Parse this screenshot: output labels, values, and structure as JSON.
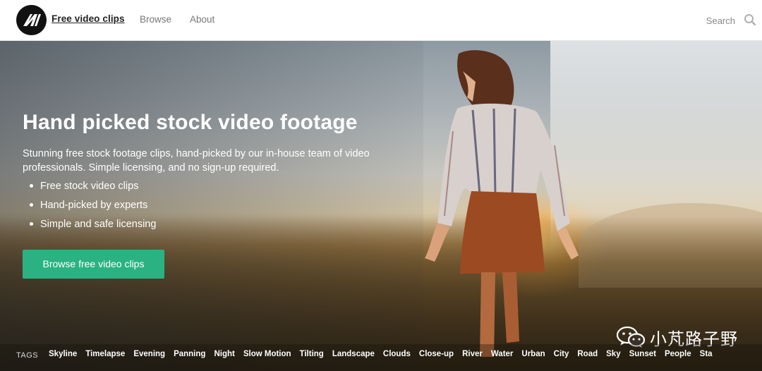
{
  "header": {
    "logo_icon": "m-logo-icon",
    "site_title": "Free video clips",
    "nav": [
      {
        "label": "Browse"
      },
      {
        "label": "About"
      }
    ],
    "search": {
      "placeholder": "Search",
      "icon": "search-icon"
    }
  },
  "hero": {
    "title": "Hand picked stock video footage",
    "description": "Stunning free stock footage clips, hand-picked by our in-house team of video professionals. Simple licensing, and no sign-up required.",
    "features": [
      "Free stock video clips",
      "Hand-picked by experts",
      "Simple and safe licensing"
    ],
    "cta_label": "Browse free video clips"
  },
  "tags": {
    "label": "TAGS",
    "items": [
      "Skyline",
      "Timelapse",
      "Evening",
      "Panning",
      "Night",
      "Slow Motion",
      "Tilting",
      "Landscape",
      "Clouds",
      "Close-up",
      "River",
      "Water",
      "Urban",
      "City",
      "Road",
      "Sky",
      "Sunset",
      "People",
      "Sta"
    ]
  },
  "watermark": {
    "icon": "wechat-icon",
    "text": "小芃路子野"
  },
  "colors": {
    "accent": "#2bb282",
    "logo_bg": "#111111"
  }
}
